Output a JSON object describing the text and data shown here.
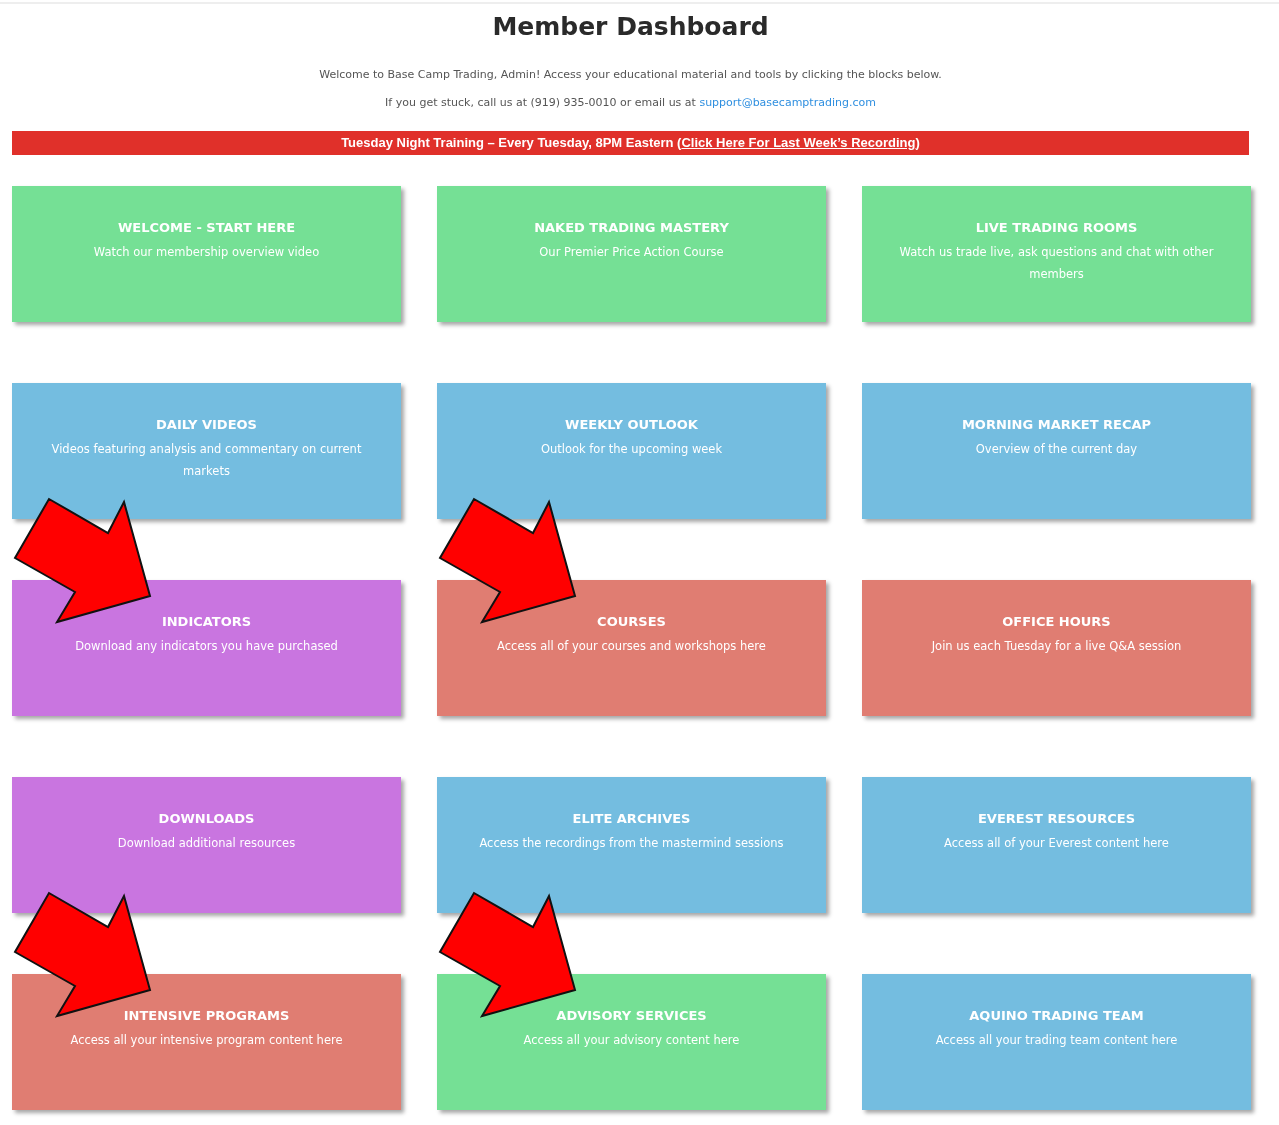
{
  "header": {
    "title": "Member Dashboard",
    "welcome": "Welcome to Base Camp Trading, Admin! Access your educational material and tools by clicking the blocks below.",
    "contact": "If you get stuck, call us at (919) 935-0010 or email us at",
    "email": "support@basecamptrading.com"
  },
  "banner": {
    "text": "Tuesday Night Training – Every Tuesday, 8PM Eastern (",
    "link": "Click Here For Last Week’s Recording",
    "suffix": ")"
  },
  "cards": [
    {
      "title": "WELCOME - START HERE",
      "description": "Watch our membership overview video",
      "color": "#75e095",
      "highlighted": false
    },
    {
      "title": "NAKED TRADING MASTERY",
      "description": "Our Premier Price Action Course",
      "color": "#75e095",
      "highlighted": false
    },
    {
      "title": "LIVE TRADING ROOMS",
      "description": "Watch us trade live, ask questions and chat with other members",
      "color": "#75e095",
      "highlighted": false
    },
    {
      "title": "DAILY VIDEOS",
      "description": "Videos featuring analysis and commentary on current markets",
      "color": "#74bde0",
      "highlighted": false
    },
    {
      "title": "WEEKLY OUTLOOK",
      "description": "Outlook for the upcoming week",
      "color": "#74bde0",
      "highlighted": false
    },
    {
      "title": "MORNING MARKET RECAP",
      "description": "Overview of the current day",
      "color": "#74bde0",
      "highlighted": false
    },
    {
      "title": "INDICATORS",
      "description": "Download any indicators you have purchased",
      "color": "#c975e0",
      "highlighted": true
    },
    {
      "title": "COURSES",
      "description": "Access all of your courses and workshops here",
      "color": "#e07d72",
      "highlighted": true
    },
    {
      "title": "OFFICE HOURS",
      "description": "Join us each Tuesday for a live Q&A session",
      "color": "#e07d72",
      "highlighted": false
    },
    {
      "title": "DOWNLOADS",
      "description": "Download additional resources",
      "color": "#c975e0",
      "highlighted": false
    },
    {
      "title": "ELITE ARCHIVES",
      "description": "Access the recordings from the mastermind sessions",
      "color": "#74bde0",
      "highlighted": false
    },
    {
      "title": "EVEREST RESOURCES",
      "description": "Access all of your Everest content here",
      "color": "#74bde0",
      "highlighted": false
    },
    {
      "title": "INTENSIVE PROGRAMS",
      "description": "Access all your intensive program content here",
      "color": "#e07d72",
      "highlighted": true
    },
    {
      "title": "ADVISORY SERVICES",
      "description": "Access all your advisory content here",
      "color": "#75e095",
      "highlighted": true
    },
    {
      "title": "AQUINO TRADING TEAM",
      "description": "Access all your trading team content here",
      "color": "#74bde0",
      "highlighted": false
    }
  ]
}
